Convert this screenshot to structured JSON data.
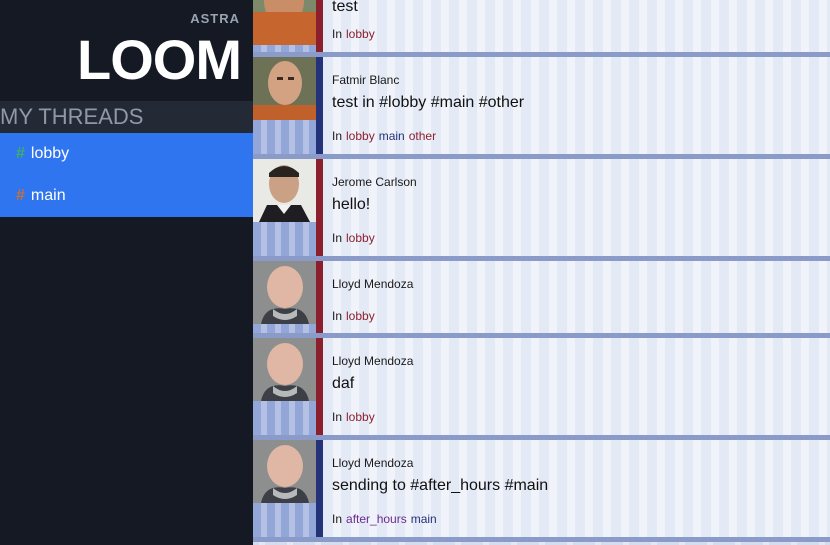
{
  "sidebar": {
    "brand_sub": "ASTRA",
    "brand": "LOOM",
    "section_title": "MY THREADS",
    "threads": [
      {
        "hash": "#",
        "label": "lobby",
        "hash_color": "#3fae6b"
      },
      {
        "hash": "#",
        "label": "main",
        "hash_color": "#c4703a"
      }
    ]
  },
  "messages": [
    {
      "author": "",
      "text": "test",
      "in_label": "In",
      "channels": [
        "lobby"
      ],
      "bar_color": "#8c1f2e"
    },
    {
      "author": "Fatmir Blanc",
      "text": "test in #lobby #main #other",
      "in_label": "In",
      "channels": [
        "lobby",
        "main",
        "other"
      ],
      "bar_color": "#24327a"
    },
    {
      "author": "Jerome Carlson",
      "text": "hello!",
      "in_label": "In",
      "channels": [
        "lobby"
      ],
      "bar_color": "#8c1f2e"
    },
    {
      "author": "Lloyd Mendoza",
      "text": "",
      "in_label": "In",
      "channels": [
        "lobby"
      ],
      "bar_color": "#8c1f2e"
    },
    {
      "author": "Lloyd Mendoza",
      "text": "daf",
      "in_label": "In",
      "channels": [
        "lobby"
      ],
      "bar_color": "#8c1f2e"
    },
    {
      "author": "Lloyd Mendoza",
      "text": "sending to #after_hours #main",
      "in_label": "In",
      "channels": [
        "after_hours",
        "main"
      ],
      "bar_color": "#24327a"
    }
  ],
  "colors": {
    "accent": "#2f75f0",
    "sidebar_bg": "#141924",
    "lobby": "#8c1f2e",
    "main": "#24327a",
    "after_hours": "#6a2b8c"
  }
}
